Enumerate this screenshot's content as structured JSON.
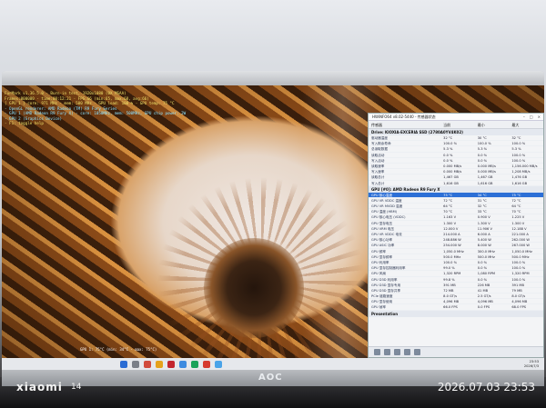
{
  "photo": {
    "watermark_brand": "xiaomi",
    "watermark_model": "14",
    "timestamp": "2026.07.03 23:53",
    "monitor_brand": "AOC"
  },
  "benchmark": {
    "osd_lines": [
      "FurMark v1.36.5.0 - Burn-in test, 1920x1080 (0X MSAA)",
      "Frames:000000 - time:00:12:21 - FPS:66 (min:65, max:68, avg:66)",
      "[ GPU 1 ] core: 971 MHz - mem: 500 MHz - GPU load: 100 % - GPU temp: 75 °C",
      "- OpenGL renderer: AMD Radeon (TM) R9 Fury Series",
      "- GPU 1 (AMD Radeon R9 Fury X) - core: 1050MHz, mem: 500MHz, GPU chip power: 2W",
      "- GPU 2 (Graphics Device)",
      "- F1: toggle help"
    ],
    "bottom_label": "GPU 1: 75°C (min: 34°C - max: 75°C)"
  },
  "sensor_window": {
    "title": "HWiNFO64 v8.02-5440 - 传感器状态",
    "columns": [
      "传感器",
      "当前",
      "最小",
      "最大"
    ],
    "groups": [
      {
        "name": "Drive: KIOXIA-EXCERIA SSD (2780A0YV4K02)",
        "rows": [
          [
            "驱动器温度",
            "32 °C",
            "30 °C",
            "32 °C"
          ],
          [
            "写入剩余寿命",
            "100.0 %",
            "100.0 %",
            "100.0 %"
          ],
          [
            "总读取数据",
            "5.3 %",
            "5.3 %",
            "5.3 %"
          ],
          [
            "读取活动",
            "0.0 %",
            "0.0 %",
            "100.0 %"
          ],
          [
            "写入活动",
            "0.0 %",
            "0.0 %",
            "100.0 %"
          ],
          [
            "读取速率",
            "0.000 MB/s",
            "0.000 MB/s",
            "1,156.000 MB/s"
          ],
          [
            "写入速率",
            "0.000 MB/s",
            "0.000 MB/s",
            "1,208 MB/s"
          ],
          [
            "读取总计",
            "1,467 GB",
            "1,467 GB",
            "1,476 GB"
          ],
          [
            "写入总计",
            "1,616 GB",
            "1,616 GB",
            "1,616 GB"
          ]
        ]
      },
      {
        "name": "GPU [#0]: AMD Radeon R9 Fury X",
        "rows": [
          [
            "GPU 核心温度",
            "75 °C",
            "34 °C",
            "75 °C"
          ],
          [
            "GPU VR VDDC 温度",
            "72 °C",
            "31 °C",
            "72 °C"
          ],
          [
            "GPU VR MVDD 温度",
            "64 °C",
            "32 °C",
            "64 °C"
          ],
          [
            "GPU 温度 (HBM)",
            "70 °C",
            "33 °C",
            "70 °C"
          ],
          [
            "GPU 核心电压 (VDDC)",
            "1.163 V",
            "0.900 V",
            "1.225 V"
          ],
          [
            "GPU 显存电压",
            "1.300 V",
            "1.300 V",
            "1.300 V"
          ],
          [
            "GPU VRM 电压",
            "12.000 V",
            "11.906 V",
            "12.188 V"
          ],
          [
            "GPU VR VDDC 电流",
            "214.000 A",
            "6.000 A",
            "221.000 A"
          ],
          [
            "GPU 核心功率",
            "248.886 W",
            "5.400 W",
            "262.000 W"
          ],
          [
            "GPU ASIC 功率",
            "254.000 W",
            "8.000 W",
            "267.000 W"
          ],
          [
            "GPU 频率",
            "1,050.0 MHz",
            "300.0 MHz",
            "1,050.0 MHz"
          ],
          [
            "GPU 显存频率",
            "500.0 MHz",
            "500.0 MHz",
            "500.0 MHz"
          ],
          [
            "GPU 利用率",
            "100.0 %",
            "0.0 %",
            "100.0 %"
          ],
          [
            "GPU 显存控制器利用率",
            "99.0 %",
            "0.0 %",
            "100.0 %"
          ],
          [
            "GPU 风扇",
            "1,320 RPM",
            "1,080 RPM",
            "1,320 RPM"
          ],
          [
            "GPU D3D 利用率",
            "99.8 %",
            "0.0 %",
            "100.0 %"
          ],
          [
            "GPU D3D 显存专用",
            "391 MB",
            "226 MB",
            "391 MB"
          ],
          [
            "GPU D3D 显存共享",
            "72 MB",
            "41 MB",
            "79 MB"
          ],
          [
            "PCIe 链路速度",
            "8.0 GT/s",
            "2.5 GT/s",
            "8.0 GT/s"
          ],
          [
            "GPU 显存使用",
            "4,096 MB",
            "4,096 MB",
            "4,096 MB"
          ],
          [
            "GPU 帧率",
            "66.0 FPS",
            "0.0 FPS",
            "68.0 FPS"
          ]
        ]
      },
      {
        "name": "Presentation",
        "rows": []
      }
    ]
  },
  "taskbar": {
    "clock_time": "23:53",
    "clock_date": "2026/7/3"
  }
}
